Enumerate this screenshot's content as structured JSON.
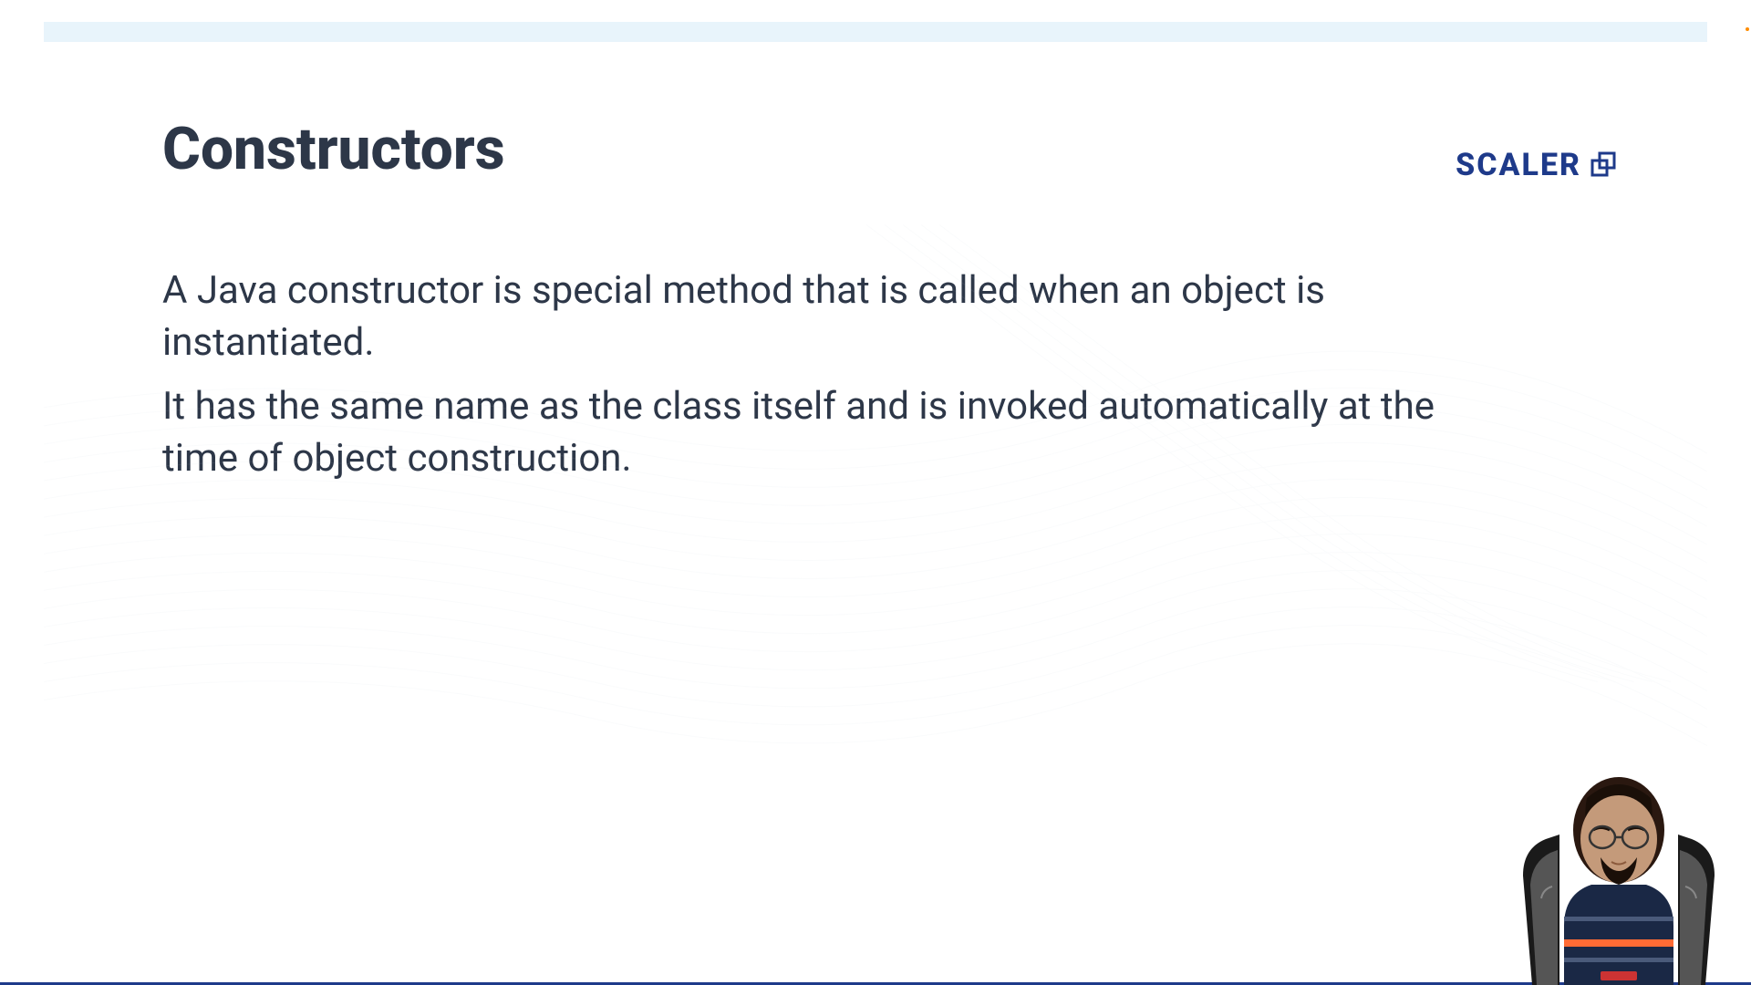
{
  "brand": {
    "name": "SCALER"
  },
  "slide": {
    "title": "Constructors",
    "paragraphs": [
      "A Java constructor is special method that is called when an object is instantiated.",
      "It has the same name as the class itself and is invoked automatically at the time of object construction."
    ]
  }
}
